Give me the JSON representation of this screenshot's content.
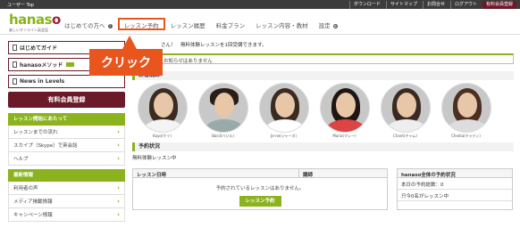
{
  "topbar": {
    "breadcrumb": "ユーザー Top",
    "links": [
      "ダウンロード",
      "サイトマップ",
      "お問合せ",
      "ログアウト"
    ],
    "paid_link": "有料会員登録"
  },
  "logo": {
    "word_a": "hanas",
    "word_o": "o",
    "tagline": "楽しいオンライン英会話"
  },
  "nav": {
    "items": [
      "はじめての方へ",
      "レッスン予約",
      "レッスン履歴",
      "料金プラン",
      "レッスン内容・教材",
      "設定"
    ],
    "active_index": 1
  },
  "callout": {
    "text": "クリック"
  },
  "sidebar": {
    "buttons": [
      "はじめてガイド",
      "hanasoメソッド",
      "News in Levels"
    ],
    "paid_button": "有料会員登録",
    "groups": [
      {
        "title": "レッスン開始にあたって",
        "links": [
          "レッスンまでの流れ",
          "スカイプ（Skype）で英会話",
          "ヘルプ"
        ]
      },
      {
        "title": "最新情報",
        "links": [
          "利用者の声",
          "メディア掲載情報",
          "キャンペーン情報"
        ]
      }
    ]
  },
  "main": {
    "welcome": "さん！　無料体験レッスンを1回受講できます。",
    "notice": "お知らせはありません",
    "teachers_title": "新着講師",
    "teachers": [
      "Kaye(ケイ)",
      "Basil(バジル)",
      "Je-ne(ジャーネ)",
      "Maria(マレー)",
      "Chant(チャム)",
      "Chedia(チャディ)"
    ],
    "status_title": "予約状況",
    "status_text": "無料体験レッスン中",
    "table": {
      "col_date": "レッスン日時",
      "col_teacher": "講師",
      "empty": "予約されているレッスンはありません。",
      "button": "レッスン予約"
    },
    "summary": {
      "title": "hanaso全体の予約状況",
      "today": "本日の予約総数：0",
      "now": "只今0名がレッスン中"
    }
  },
  "colors": {
    "accent_green": "#8ab31d",
    "brand_maroon": "#6b1a2a",
    "callout_orange": "#e8561e"
  }
}
